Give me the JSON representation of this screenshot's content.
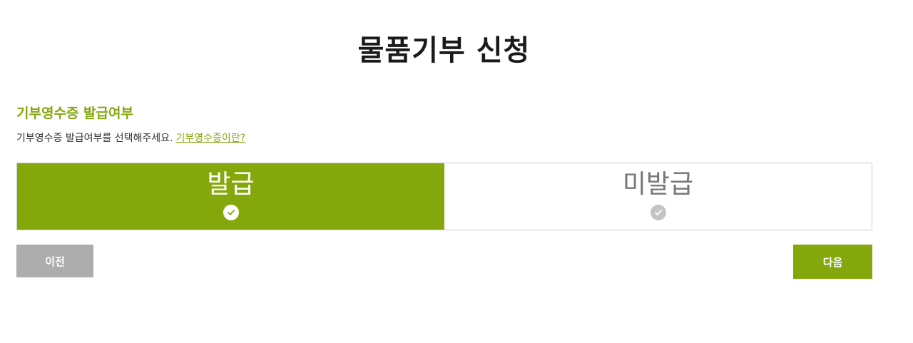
{
  "page": {
    "title": "물품기부 신청"
  },
  "receipt_section": {
    "title": "기부영수증 발급여부",
    "description": "기부영수증 발급여부를 선택해주세요.",
    "help_link": "기부영수증이란?"
  },
  "options": {
    "issue": {
      "label": "발급",
      "selected": true
    },
    "no_issue": {
      "label": "미발급",
      "selected": false
    }
  },
  "buttons": {
    "prev_label": "이전",
    "next_label": "다음"
  },
  "colors": {
    "accent": "#84a80b",
    "prev_button": "#adadad",
    "unselected_check": "#c4c4c4"
  },
  "icons": {
    "check": "check-circle-icon"
  }
}
